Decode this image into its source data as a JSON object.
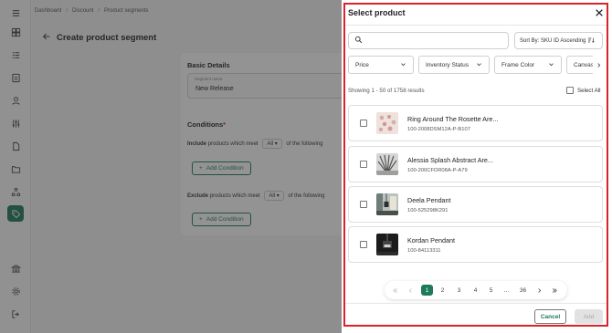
{
  "breadcrumb": [
    "Dashboard",
    "Discount",
    "Product segments"
  ],
  "page": {
    "title": "Create product segment"
  },
  "basic_details": {
    "heading": "Basic Details",
    "segment_name_label": "Segment name",
    "segment_name_value": "New Release"
  },
  "conditions": {
    "heading": "Conditions",
    "required_mark": "*",
    "include_bold": "Include",
    "include_text": "products which meet",
    "include_select": "All",
    "include_suffix": "of the following",
    "exclude_bold": "Exclude",
    "exclude_text": "products which meet",
    "exclude_select": "All",
    "exclude_suffix": "of the following",
    "add_condition_label": "Add Condition"
  },
  "drawer": {
    "title": "Select product",
    "search_placeholder": "",
    "sort_label": "Sort By: SKU ID Ascending",
    "filters": [
      "Price",
      "Inventory Status",
      "Frame Color",
      "Canvas"
    ],
    "showing_text": "Showing 1 - 50 of 1758 results",
    "select_all_label": "Select All",
    "products": [
      {
        "name": "Ring Around The Rosette Are...",
        "sku": "100-2008DSM12A-P-B107",
        "thumb": "pink-pattern"
      },
      {
        "name": "Alessia Splash Abstract Are...",
        "sku": "100-200CFDR08A-P-A79",
        "thumb": "gray-splash"
      },
      {
        "name": "Deela Pendant",
        "sku": "100-525298K291",
        "thumb": "room-pendant"
      },
      {
        "name": "Kordan Pendant",
        "sku": "100-84113311",
        "thumb": "dark-pendant"
      }
    ],
    "pagination": {
      "pages": [
        "1",
        "2",
        "3",
        "4",
        "5",
        "...",
        "36"
      ],
      "current": "1"
    },
    "cancel_label": "Cancel",
    "add_label": "Add"
  },
  "colors": {
    "accent": "#1f7a5a",
    "highlight_frame": "#d9232a",
    "overlay": "#282828"
  },
  "sidebar_icons": [
    "dashboard-icon",
    "list-icon",
    "document-icon",
    "user-icon",
    "sliders-icon",
    "file-icon",
    "folder-icon",
    "network-icon",
    "tag-icon",
    "bank-icon",
    "gear-icon",
    "logout-icon"
  ]
}
